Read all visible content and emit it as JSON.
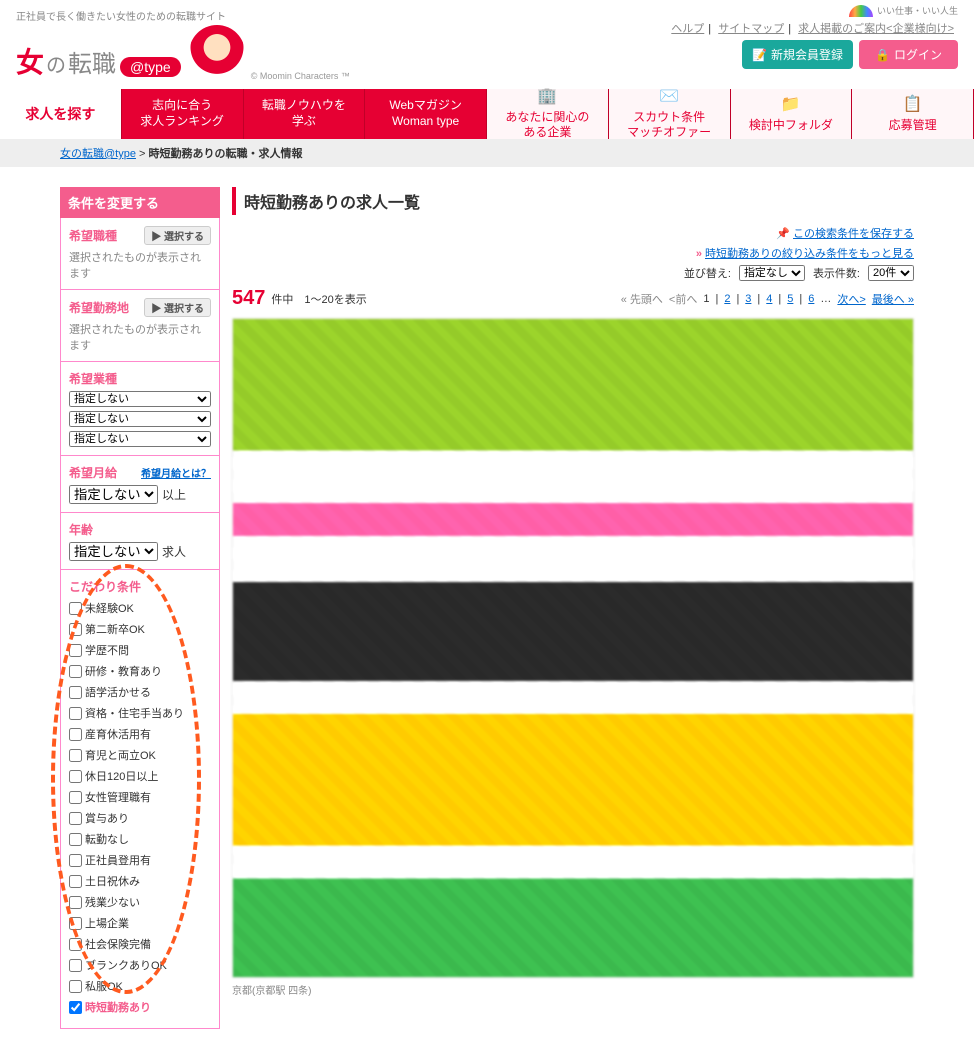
{
  "header": {
    "tagline": "正社員で長く働きたい女性のための転職サイト",
    "logo": {
      "onna": "女",
      "no": "の",
      "tenshoku": "転職",
      "badge": "@type"
    },
    "moomin_credit": "© Moomin Characters ™",
    "top_links": [
      "ヘルプ",
      "サイトマップ",
      "求人掲載のご案内<企業様向け>"
    ],
    "btn_register": "新規会員登録",
    "btn_login": "ログイン",
    "rainbow_label": "いい仕事・いい人生"
  },
  "nav": {
    "tabs": [
      {
        "label1": "求人を探す",
        "label2": ""
      },
      {
        "label1": "志向に合う",
        "label2": "求人ランキング"
      },
      {
        "label1": "転職ノウハウを",
        "label2": "学ぶ"
      },
      {
        "label1": "Webマガジン",
        "label2": "Woman type"
      },
      {
        "label1": "あなたに関心の",
        "label2": "ある企業"
      },
      {
        "label1": "スカウト条件",
        "label2": "マッチオファー"
      },
      {
        "label1": "検討中フォルダ",
        "label2": ""
      },
      {
        "label1": "応募管理",
        "label2": ""
      }
    ]
  },
  "breadcrumb": {
    "home": "女の転職@type",
    "sep": ">",
    "current": "時短勤務ありの転職・求人情報"
  },
  "sidebar": {
    "header": "条件を変更する",
    "select_btn": "選択する",
    "blocks": {
      "job_type": {
        "title": "希望職種",
        "text": "選択されたものが表示されます"
      },
      "location": {
        "title": "希望勤務地",
        "text": "選択されたものが表示されます"
      },
      "industry": {
        "title": "希望業種",
        "options": [
          "指定しない",
          "指定しない",
          "指定しない"
        ]
      },
      "salary": {
        "title": "希望月給",
        "sublink": "希望月給とは？",
        "option": "指定しない",
        "suffix": "以上"
      },
      "age": {
        "title": "年齢",
        "option": "指定しない",
        "suffix": "求人"
      },
      "conditions": {
        "title": "こだわり条件",
        "items": [
          "未経験OK",
          "第二新卒OK",
          "学歴不問",
          "研修・教育あり",
          "語学活かせる",
          "資格・住宅手当あり",
          "産育休活用有",
          "育児と両立OK",
          "休日120日以上",
          "女性管理職有",
          "賞与あり",
          "転勤なし",
          "正社員登用有",
          "土日祝休み",
          "残業少ない",
          "上場企業",
          "社会保険完備",
          "ブランクありOK",
          "私服OK",
          "時短勤務あり"
        ],
        "checked_index": 19
      }
    }
  },
  "main": {
    "title": "時短勤務ありの求人一覧",
    "save_link": "この検索条件を保存する",
    "more_link": "時短勤務ありの絞り込み条件をもっと見る",
    "sort_label": "並び替え:",
    "sort_value": "指定なし",
    "per_page_label": "表示件数:",
    "per_page_value": "20件",
    "count": "547",
    "count_suffix": "件中　1～20を表示",
    "pager": {
      "first": "先頭へ",
      "prev": "<前へ",
      "pages": [
        "1",
        "2",
        "3",
        "4",
        "5",
        "6"
      ],
      "dots": "…",
      "next": "次へ>",
      "last": "最後へ"
    },
    "loc_footer": "京都(京都駅 四条)"
  }
}
